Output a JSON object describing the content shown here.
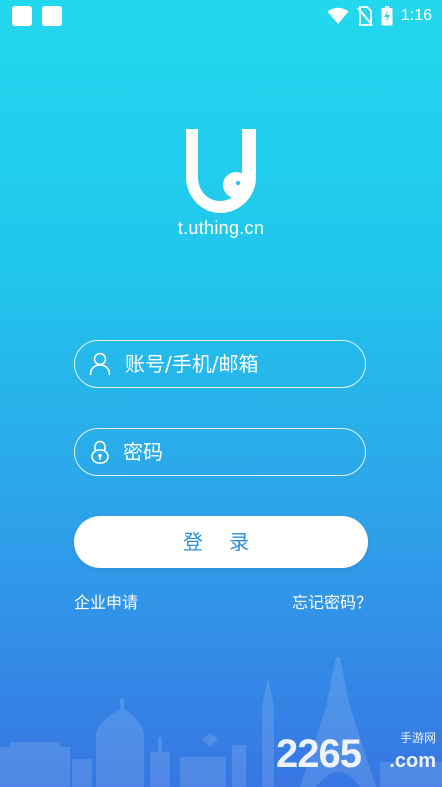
{
  "status_bar": {
    "time": "1:16",
    "icons": [
      "notification-square-icon",
      "notification-square-icon",
      "wifi-icon",
      "no-sim-icon",
      "battery-charging-icon"
    ]
  },
  "brand": {
    "logo": "uthing-bird-logo",
    "domain": "t.uthing.cn"
  },
  "login_form": {
    "account_placeholder": "账号/手机/邮箱",
    "password_placeholder": "密码",
    "login_label": "登 录"
  },
  "links": {
    "enterprise_apply": "企业申请",
    "forgot_password": "忘记密码？"
  },
  "watermark": {
    "number": "2265",
    "domain": ".com",
    "site": "手游网"
  },
  "colors": {
    "gradient_top": "#23d8ee",
    "gradient_bottom": "#3776e3",
    "login_text": "#2a8ee0"
  }
}
